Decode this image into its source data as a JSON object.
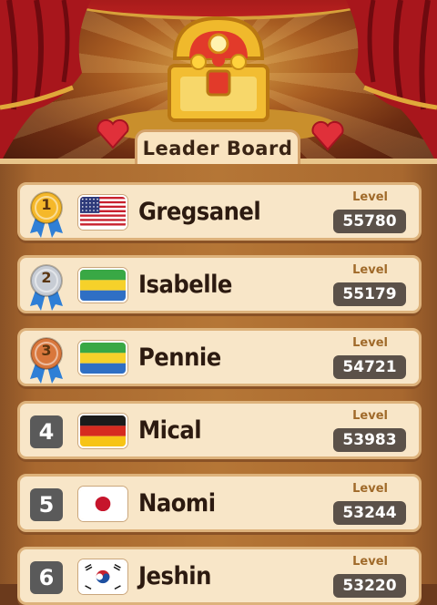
{
  "title": "Leader Board",
  "level_label": "Level",
  "players": [
    {
      "rank": "1",
      "name": "Gregsanel",
      "level": "55780",
      "flag": "usa-flag-icon",
      "medal": "gold"
    },
    {
      "rank": "2",
      "name": "Isabelle",
      "level": "55179",
      "flag": "gabon-flag-icon",
      "medal": "silver"
    },
    {
      "rank": "3",
      "name": "Pennie",
      "level": "54721",
      "flag": "gabon-flag-icon",
      "medal": "bronze"
    },
    {
      "rank": "4",
      "name": "Mical",
      "level": "53983",
      "flag": "germany-flag-icon",
      "medal": ""
    },
    {
      "rank": "5",
      "name": "Naomi",
      "level": "53244",
      "flag": "japan-flag-icon",
      "medal": ""
    },
    {
      "rank": "6",
      "name": "Jeshin",
      "level": "53220",
      "flag": "south-korea-flag-icon",
      "medal": ""
    }
  ],
  "colors": {
    "gold": "#f5b82a",
    "silver": "#c7ccd4",
    "bronze": "#d9773c",
    "ribbon": "#2f7fd6"
  }
}
